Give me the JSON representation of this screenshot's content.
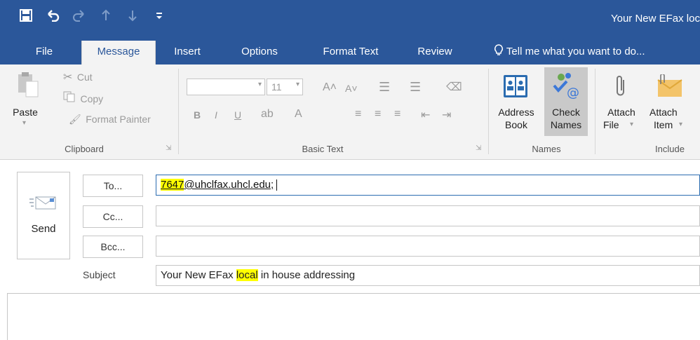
{
  "window": {
    "title": "Your New EFax loc"
  },
  "qat": {
    "save_icon": "save-icon",
    "undo_icon": "undo-icon",
    "redo_icon": "redo-icon",
    "up_icon": "up-arrow-icon",
    "down_icon": "down-arrow-icon",
    "customize_icon": "customize-icon"
  },
  "tabs": [
    {
      "label": "File"
    },
    {
      "label": "Message"
    },
    {
      "label": "Insert"
    },
    {
      "label": "Options"
    },
    {
      "label": "Format Text"
    },
    {
      "label": "Review"
    }
  ],
  "tell_me": "Tell me what you want to do...",
  "ribbon": {
    "clipboard": {
      "paste": "Paste",
      "cut": "Cut",
      "copy": "Copy",
      "format_painter": "Format Painter",
      "label": "Clipboard"
    },
    "basic_text": {
      "font_size": "11",
      "bold": "B",
      "italic": "I",
      "underline": "U",
      "label": "Basic Text"
    },
    "names": {
      "address_book_1": "Address",
      "address_book_2": "Book",
      "check_names_1": "Check",
      "check_names_2": "Names",
      "label": "Names"
    },
    "include": {
      "attach_file_1": "Attach",
      "attach_file_2": "File",
      "attach_item_1": "Attach",
      "attach_item_2": "Item",
      "label": "Include"
    }
  },
  "compose": {
    "send": "Send",
    "to_label": "To...",
    "cc_label": "Cc...",
    "bcc_label": "Bcc...",
    "subject_label": "Subject",
    "to_number": "7647",
    "to_rest": "@uhclfax.uhcl.edu;",
    "subject_pre": "Your New EFax ",
    "subject_hl": "local",
    "subject_post": " in house addressing"
  },
  "colors": {
    "accent": "#2b579a",
    "highlight": "#ffff00"
  }
}
